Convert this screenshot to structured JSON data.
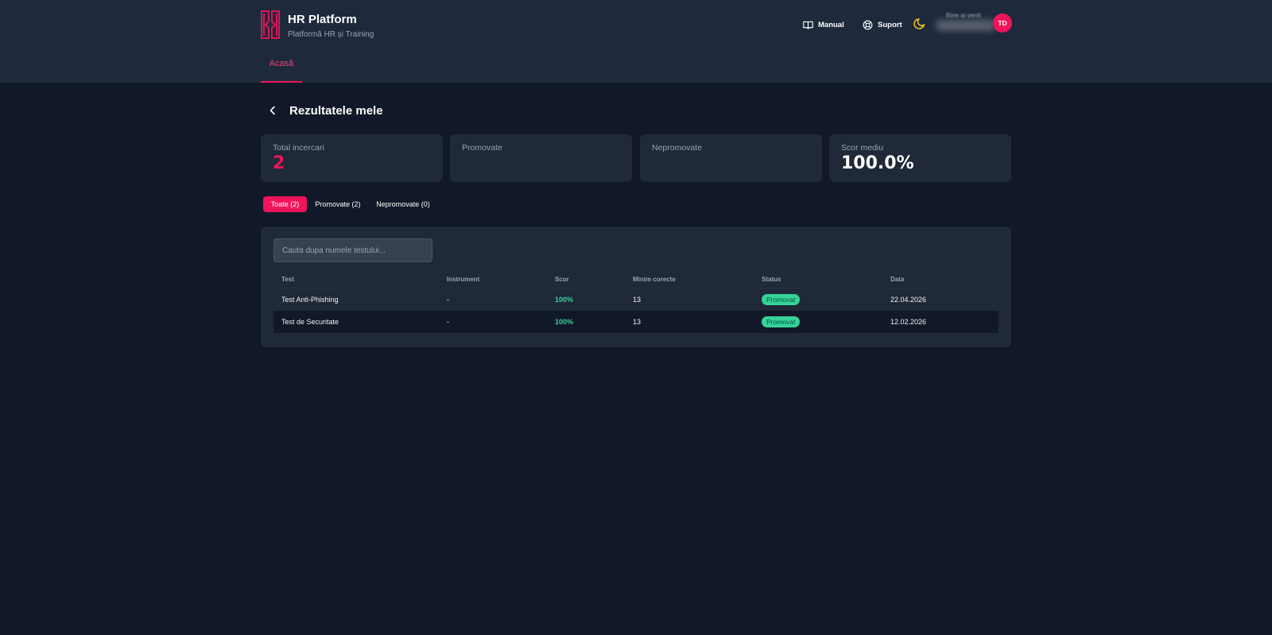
{
  "app": {
    "title": "HR Platform",
    "subtitle": "Platformă HR și Training"
  },
  "header": {
    "manual_label": "Manual",
    "support_label": "Suport",
    "user_greeting": "Bine ai venit",
    "avatar_initials": "TD"
  },
  "nav": {
    "home_label": "Acasă"
  },
  "page": {
    "title": "Rezultatele mele"
  },
  "stats": [
    {
      "label": "Total incercari",
      "value": "2"
    },
    {
      "label": "Promovate",
      "value": ""
    },
    {
      "label": "Nepromovate",
      "value": ""
    },
    {
      "label": "Scor mediu",
      "value": "100.0%"
    }
  ],
  "filters": [
    {
      "label": "Toate (2)",
      "active": true
    },
    {
      "label": "Promovate (2)",
      "active": false
    },
    {
      "label": "Nepromovate (0)",
      "active": false
    }
  ],
  "search": {
    "placeholder": "Cauta dupa numele testului..."
  },
  "table": {
    "headers": [
      "Test",
      "Instrument",
      "Scor",
      "Minim corecte",
      "Status",
      "Data"
    ],
    "rows": [
      {
        "test": "Test Anti-Phishing",
        "instrument": "-",
        "score": "100%",
        "min_correct": "13",
        "status": "Promovat",
        "date": "22.04.2026"
      },
      {
        "test": "Test de Securitate",
        "instrument": "-",
        "score": "100%",
        "min_correct": "13",
        "status": "Promovat",
        "date": "12.02.2026"
      }
    ]
  },
  "colors": {
    "accent": "#f0145a",
    "success": "#34d399",
    "background": "#111827",
    "header_bg": "#1e293b",
    "card_bg": "#1f2937",
    "moon": "#facc15"
  },
  "icons": {
    "logo": "brand-logo-icon",
    "manual": "book-open-icon",
    "support": "lifebuoy-icon",
    "theme": "moon-icon",
    "back": "chevron-left-icon"
  }
}
